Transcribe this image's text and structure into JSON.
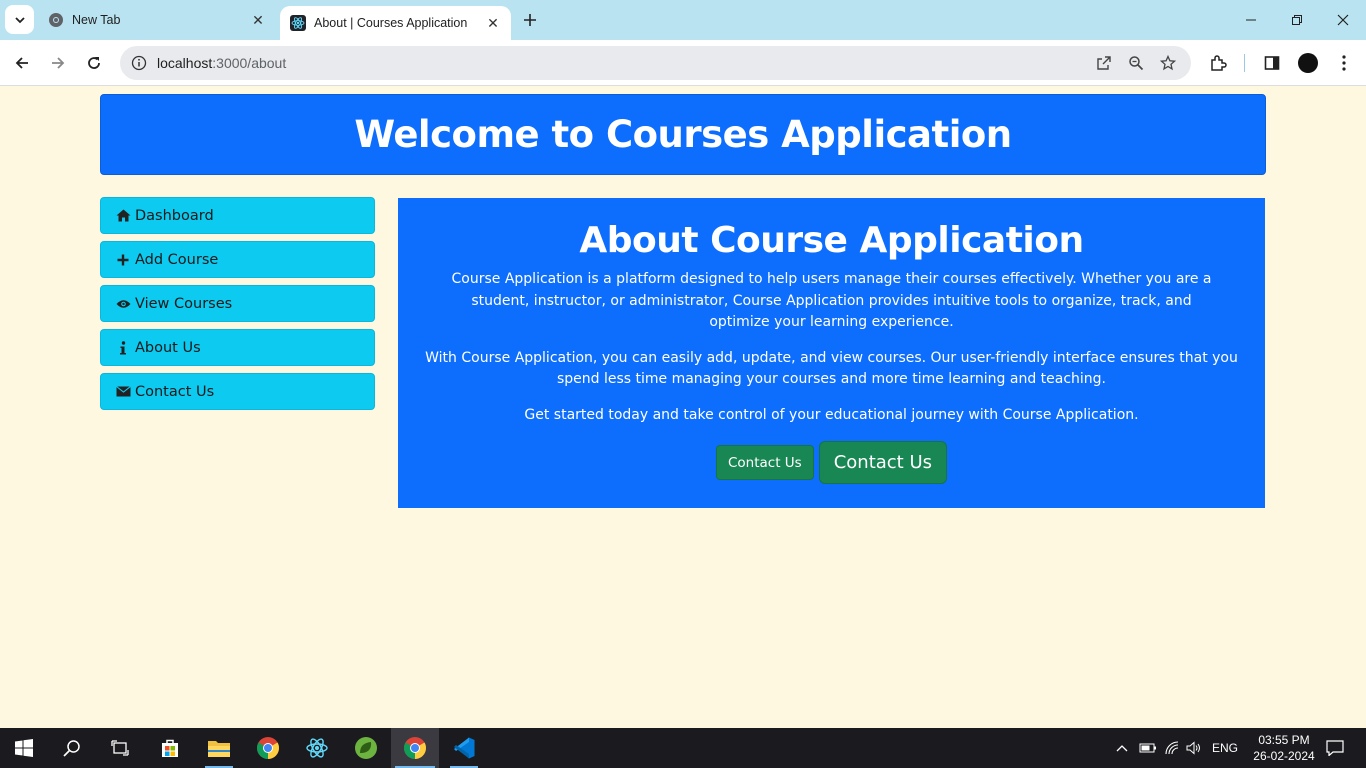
{
  "browser": {
    "tabs": [
      {
        "title": "New Tab",
        "active": false
      },
      {
        "title": "About | Courses Application",
        "active": true
      }
    ],
    "url_host": "localhost",
    "url_path": ":3000/about"
  },
  "header": {
    "title": "Welcome to Courses Application"
  },
  "sidebar": {
    "items": [
      {
        "label": "Dashboard",
        "icon": "home-icon"
      },
      {
        "label": "Add Course",
        "icon": "plus-icon"
      },
      {
        "label": "View Courses",
        "icon": "eye-icon"
      },
      {
        "label": "About Us",
        "icon": "info-icon"
      },
      {
        "label": "Contact Us",
        "icon": "envelope-icon"
      }
    ]
  },
  "main": {
    "title": "About Course Application",
    "paragraphs": [
      "Course Application is a platform designed to help users manage their courses effectively. Whether you are a student, instructor, or administrator, Course Application provides intuitive tools to organize, track, and optimize your learning experience.",
      "With Course Application, you can easily add, update, and view courses. Our user-friendly interface ensures that you spend less time managing your courses and more time learning and teaching.",
      "Get started today and take control of your educational journey with Course Application."
    ],
    "button_small": "Contact Us",
    "button_large": "Contact Us"
  },
  "taskbar": {
    "language": "ENG",
    "time": "03:55 PM",
    "date": "26-02-2024"
  },
  "colors": {
    "primary": "#0d6efd",
    "info": "#0dcaf0",
    "success": "#198754",
    "page_bg": "#fff8e1"
  }
}
